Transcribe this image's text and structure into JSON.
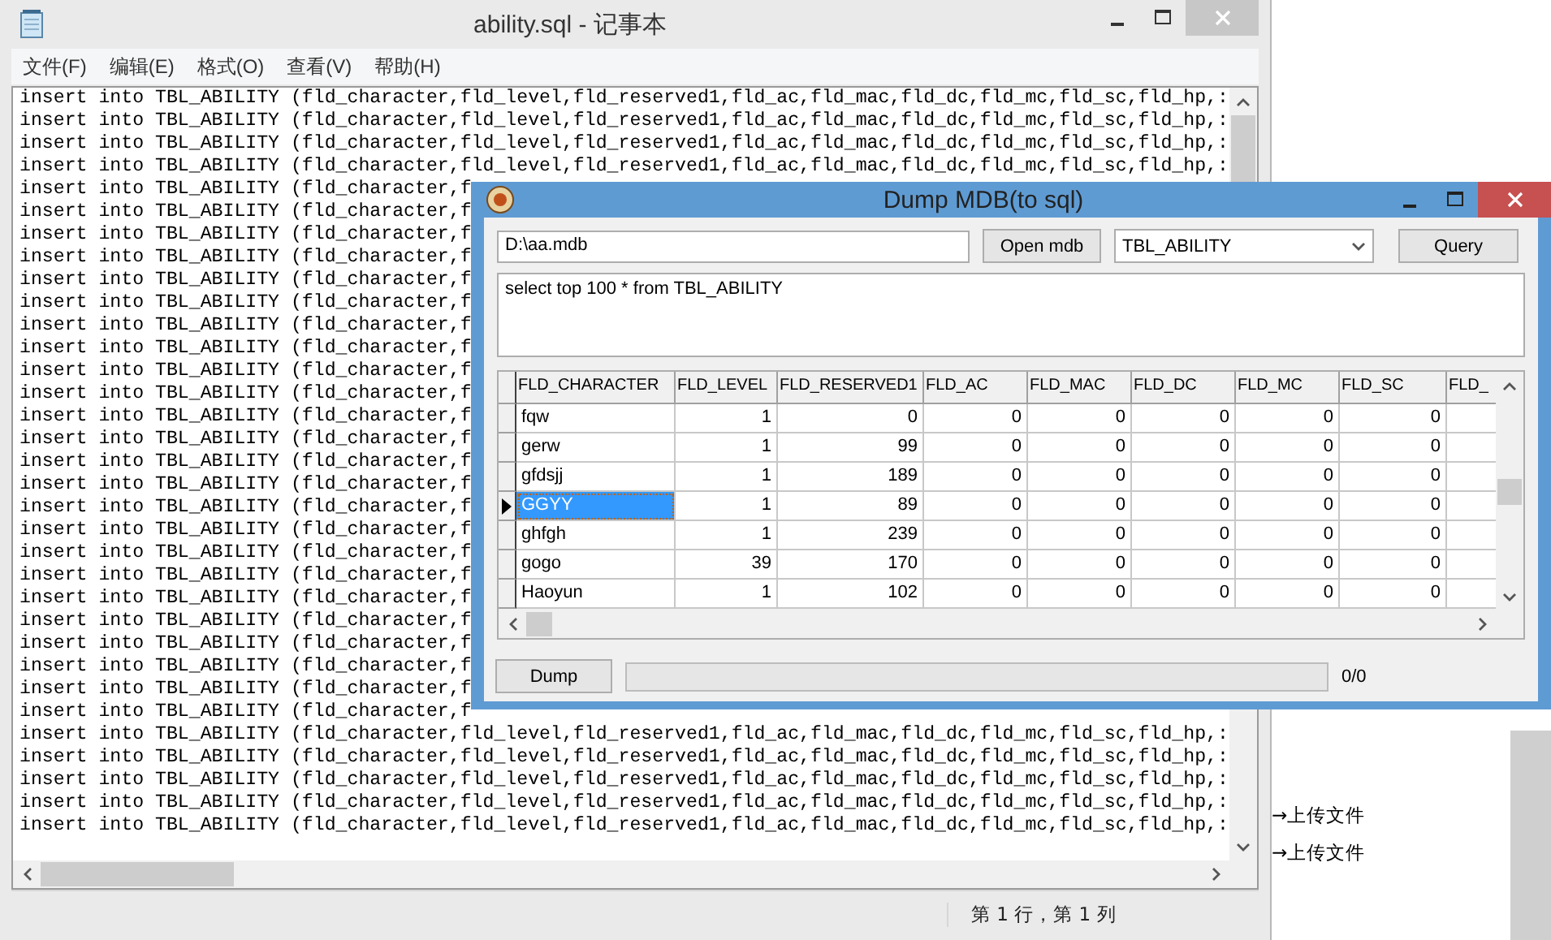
{
  "notepad": {
    "title": "ability.sql - 记事本",
    "menu": [
      "文件(F)",
      "编辑(E)",
      "格式(O)",
      "查看(V)",
      "帮助(H)"
    ],
    "lines": [
      "insert into TBL_ABILITY (fld_character,fld_level,fld_reserved1,fld_ac,fld_mac,fld_dc,fld_mc,fld_sc,fld_hp,:",
      "insert into TBL_ABILITY (fld_character,fld_level,fld_reserved1,fld_ac,fld_mac,fld_dc,fld_mc,fld_sc,fld_hp,:",
      "insert into TBL_ABILITY (fld_character,fld_level,fld_reserved1,fld_ac,fld_mac,fld_dc,fld_mc,fld_sc,fld_hp,:",
      "insert into TBL_ABILITY (fld_character,fld_level,fld_reserved1,fld_ac,fld_mac,fld_dc,fld_mc,fld_sc,fld_hp,:",
      "insert into TBL_ABILITY (fld_character,f",
      "insert into TBL_ABILITY (fld_character,f",
      "insert into TBL_ABILITY (fld_character,f",
      "insert into TBL_ABILITY (fld_character,f",
      "insert into TBL_ABILITY (fld_character,f",
      "insert into TBL_ABILITY (fld_character,f",
      "insert into TBL_ABILITY (fld_character,f",
      "insert into TBL_ABILITY (fld_character,f",
      "insert into TBL_ABILITY (fld_character,f",
      "insert into TBL_ABILITY (fld_character,f",
      "insert into TBL_ABILITY (fld_character,f",
      "insert into TBL_ABILITY (fld_character,f",
      "insert into TBL_ABILITY (fld_character,f",
      "insert into TBL_ABILITY (fld_character,f",
      "insert into TBL_ABILITY (fld_character,f",
      "insert into TBL_ABILITY (fld_character,f",
      "insert into TBL_ABILITY (fld_character,f",
      "insert into TBL_ABILITY (fld_character,f",
      "insert into TBL_ABILITY (fld_character,f",
      "insert into TBL_ABILITY (fld_character,f",
      "insert into TBL_ABILITY (fld_character,f",
      "insert into TBL_ABILITY (fld_character,f",
      "insert into TBL_ABILITY (fld_character,f",
      "insert into TBL_ABILITY (fld_character,f",
      "insert into TBL_ABILITY (fld_character,fld_level,fld_reserved1,fld_ac,fld_mac,fld_dc,fld_mc,fld_sc,fld_hp,:",
      "insert into TBL_ABILITY (fld_character,fld_level,fld_reserved1,fld_ac,fld_mac,fld_dc,fld_mc,fld_sc,fld_hp,:",
      "insert into TBL_ABILITY (fld_character,fld_level,fld_reserved1,fld_ac,fld_mac,fld_dc,fld_mc,fld_sc,fld_hp,:",
      "insert into TBL_ABILITY (fld_character,fld_level,fld_reserved1,fld_ac,fld_mac,fld_dc,fld_mc,fld_sc,fld_hp,:",
      "insert into TBL_ABILITY (fld_character,fld_level,fld_reserved1,fld_ac,fld_mac,fld_dc,fld_mc,fld_sc,fld_hp,:"
    ],
    "status": "第 1 行，第 1 列"
  },
  "desktop_labels": [
    "→上传文件",
    "→上传文件"
  ],
  "dialog": {
    "title": "Dump MDB(to sql)",
    "path_field": {
      "value": "D:\\aa.mdb"
    },
    "open_button": "Open mdb",
    "table_select": {
      "value": "TBL_ABILITY"
    },
    "query_button": "Query",
    "sql_field": {
      "value": "select top 100 * from TBL_ABILITY"
    },
    "grid": {
      "columns": [
        "FLD_CHARACTER",
        "FLD_LEVEL",
        "FLD_RESERVED1",
        "FLD_AC",
        "FLD_MAC",
        "FLD_DC",
        "FLD_MC",
        "FLD_SC",
        "FLD_"
      ],
      "rows": [
        {
          "cells": [
            "fqw",
            "1",
            "0",
            "0",
            "0",
            "0",
            "0",
            "0"
          ],
          "selected": false
        },
        {
          "cells": [
            "gerw",
            "1",
            "99",
            "0",
            "0",
            "0",
            "0",
            "0"
          ],
          "selected": false
        },
        {
          "cells": [
            "gfdsjj",
            "1",
            "189",
            "0",
            "0",
            "0",
            "0",
            "0"
          ],
          "selected": false
        },
        {
          "cells": [
            "GGYY",
            "1",
            "89",
            "0",
            "0",
            "0",
            "0",
            "0"
          ],
          "selected": true
        },
        {
          "cells": [
            "ghfgh",
            "1",
            "239",
            "0",
            "0",
            "0",
            "0",
            "0"
          ],
          "selected": false
        },
        {
          "cells": [
            "gogo",
            "39",
            "170",
            "0",
            "0",
            "0",
            "0",
            "0"
          ],
          "selected": false
        },
        {
          "cells": [
            "Haoyun",
            "1",
            "102",
            "0",
            "0",
            "0",
            "0",
            "0"
          ],
          "selected": false
        }
      ]
    },
    "dump_button": "Dump",
    "progress": {
      "level": 0
    },
    "progress_text": "0/0"
  }
}
